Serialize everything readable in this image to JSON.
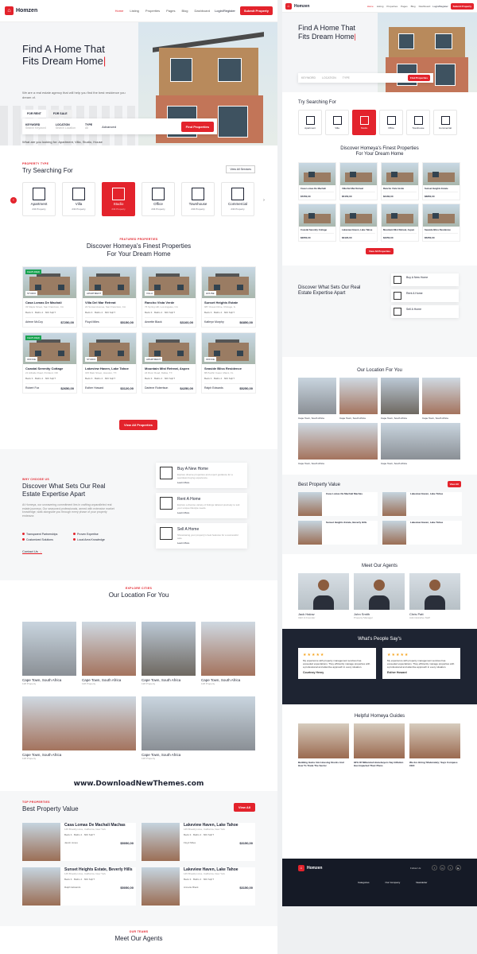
{
  "brand": "Homzen",
  "colors": {
    "accent": "#e3232c",
    "dark": "#1e2432"
  },
  "nav": {
    "items": [
      "Home",
      "Listing",
      "Properties",
      "Pages",
      "Blog",
      "Dashboard"
    ],
    "login": "Login/Register",
    "submit": "Submit Property"
  },
  "hero": {
    "title_l1": "Find A Home That",
    "title_l2": "Fits Dream Home",
    "desc": "We are a real estate agency that will help you find the best residence you dream of.",
    "tab_rent": "FOR RENT",
    "tab_sale": "FOR SALE",
    "keyword_lbl": "KEYWORD",
    "keyword_ph": "Search Keyword",
    "location_lbl": "LOCATION",
    "location_ph": "Search Location",
    "type_lbl": "TYPE",
    "type_val": "All",
    "advanced": "Advanced",
    "find": "Find Properties",
    "looking": "What are you looking for: Apartment, Villa, Studio, House"
  },
  "ptype": {
    "label": "PROPERTY TYPE",
    "title": "Try Searching For",
    "all": "View All Services",
    "items": [
      {
        "n": "Apartment",
        "c": "234 Property"
      },
      {
        "n": "Villa",
        "c": "234 Property"
      },
      {
        "n": "Studio",
        "c": "234 Property"
      },
      {
        "n": "Office",
        "c": "234 Property"
      },
      {
        "n": "Townhouse",
        "c": "234 Property"
      },
      {
        "n": "Commercial",
        "c": "234 Property"
      }
    ]
  },
  "featured": {
    "label": "FEATURED PROPERTIES",
    "title1": "Discover Homeya's Finest Properties",
    "title2": "For Your Dream Home",
    "all": "View All Properties",
    "cards": [
      {
        "t": "Casa Lomas De Machalí",
        "a": "33 Maple Street, San Francisco, CA",
        "ty": "STUDIO",
        "p": "$7250,00",
        "ag": "Arlene McCoy"
      },
      {
        "t": "Villa Del Mar Retreat",
        "a": "22 Sunset Avenue, San Francisco, CA",
        "ty": "APARTMENT",
        "p": "$5150,00",
        "ag": "Floyd Miles"
      },
      {
        "t": "Rancho Vista Verde",
        "a": "76 Spring Hill, Los Angeles, CA",
        "ty": "VILLA",
        "p": "$3160,00",
        "ag": "Annette Black"
      },
      {
        "t": "Sunset Heights Estate",
        "a": "987 Ocean Drive, Chicago, IL",
        "ty": "HOUSE",
        "p": "$6850,00",
        "ag": "Kathryn Murphy"
      },
      {
        "t": "Coastal Serenity Cottage",
        "a": "21 Hillside Road, Portland, OR",
        "ty": "OFFICE",
        "p": "$2650,00",
        "ag": "Robert Fox"
      },
      {
        "t": "Lakeview Haven, Lake Tahoe",
        "a": "315 Main Street, Houston, TX",
        "ty": "STUDIO",
        "p": "$3120,00",
        "ag": "Esther Howard"
      },
      {
        "t": "Mountain Mist Retreat, Aspen",
        "a": "24 River Road, Dallas, TX",
        "ty": "APARTMENT",
        "p": "$4250,00",
        "ag": "Darlene Robertson"
      },
      {
        "t": "Seaside Bliss Residence",
        "a": "88 Pacific Coast, Miami, FL",
        "ty": "OFFICE",
        "p": "$5250,00",
        "ag": "Ralph Edwards"
      }
    ],
    "beds": "Beds 3",
    "baths": "Baths 2",
    "sqft": "600 SqFT"
  },
  "services": {
    "label": "WHY CHOOSE US",
    "title1": "Discover What Sets Our Real",
    "title2": "Estate Expertise Apart",
    "desc": "At Homeya, our unwavering commitment lies in crafting unparalleled real estate journeys. Our seasoned professionals, armed with extensive market knowledge, walk alongside you through every phase of your property endeavor.",
    "bullets": [
      "Transparent Partnerships",
      "Proven Expertise",
      "Customized Solutions",
      "Local Area Knowledge"
    ],
    "contact": "Contact Us",
    "items": [
      {
        "t": "Buy A New Home",
        "d": "Explore diverse properties and expert guidance for a seamless buying experience.",
        "m": "Learn More"
      },
      {
        "t": "Rent A Home",
        "d": "Explore a diverse variety of listings tailored precisely to suit your unique lifestyle needs.",
        "m": "Learn More"
      },
      {
        "t": "Sell A Home",
        "d": "Showcasing your property's best features for a successful sale.",
        "m": "Learn More"
      }
    ]
  },
  "cities": {
    "label": "EXPLORE CITIES",
    "title": "Our Location For You",
    "items": [
      {
        "n": "Cape Town, South Africa",
        "c": "128 Property"
      },
      {
        "n": "Cape Town, South Africa",
        "c": "128 Property"
      },
      {
        "n": "Cape Town, South Africa",
        "c": "128 Property"
      },
      {
        "n": "Cape Town, South Africa",
        "c": "128 Property"
      },
      {
        "n": "Cape Town, South Africa",
        "c": "128 Property"
      },
      {
        "n": "Cape Town, South Africa",
        "c": "128 Property"
      }
    ]
  },
  "best": {
    "label": "TOP PROPERTIES",
    "title": "Best Property Value",
    "all": "View All",
    "items": [
      {
        "t": "Casa Lomas De Machalí Machas",
        "a": "145 Brooklyn Ave, California, New York",
        "ag": "Jacob Jones",
        "p": "$5050,00",
        "ty": "STUDIO"
      },
      {
        "t": "Lakeview Haven, Lake Tahoe",
        "a": "145 Brooklyn Ave, California, New York",
        "ag": "Floyd Miles",
        "p": "$3150,00",
        "ty": "VILLA"
      },
      {
        "t": "Sunset Heights Estate, Beverly Hills",
        "a": "145 Brooklyn Ave, California, New York",
        "ag": "Ralph Edwards",
        "p": "$5050,00",
        "ty": "HOUSE"
      },
      {
        "t": "Lakeview Haven, Lake Tahoe",
        "a": "145 Brooklyn Ave, California, New York",
        "ag": "Annette Black",
        "p": "$3150,00",
        "ty": "OFFICE"
      }
    ]
  },
  "agents": {
    "label": "OUR TEAMS",
    "title": "Meet Our Agents",
    "items": [
      {
        "n": "Jack Halow",
        "r": "CEO & Founder"
      },
      {
        "n": "John Smith",
        "r": "Property Manager"
      },
      {
        "n": "Chris Patt",
        "r": "Administrative Staff"
      }
    ]
  },
  "testimonials": {
    "label": "OUR TESTIMONIALS",
    "title": "What's People Say's",
    "items": [
      {
        "q": "My experience with property management services has exceeded expectations. They efficiently manage properties with a professional and attentive approach in every situation.",
        "n": "Courtney Henry",
        "r": "CEO Themesflat"
      },
      {
        "q": "My experience with property management services has exceeded expectations. They efficiently manage properties with a professional and attentive approach in every situation.",
        "n": "Esther Howard",
        "r": "CEO Themesflat"
      }
    ]
  },
  "guides": {
    "label": "LATEST NEW",
    "title": "Helpful Homeya Guides",
    "items": [
      {
        "t": "Building Gains Into Housing Stocks And How To Trade The Sector",
        "d": "The average contract interest rate for 30-year fixed-rate mortgages"
      },
      {
        "t": "92% Of Millennial Homebuyers Say Inflation Has Impacted Their Plans",
        "d": "Mortgage applications to purchase a home increased last week"
      },
      {
        "t": "We Are Hiring 'Moderately,' Says Compass CEO",
        "d": "New listings are up but still low compared to a year ago"
      }
    ]
  },
  "footer": {
    "follow": "Follow Us:",
    "cols": [
      "Categories",
      "Our Company",
      "Newsletter"
    ]
  },
  "watermark": "www.DownloadNewThemes.com"
}
